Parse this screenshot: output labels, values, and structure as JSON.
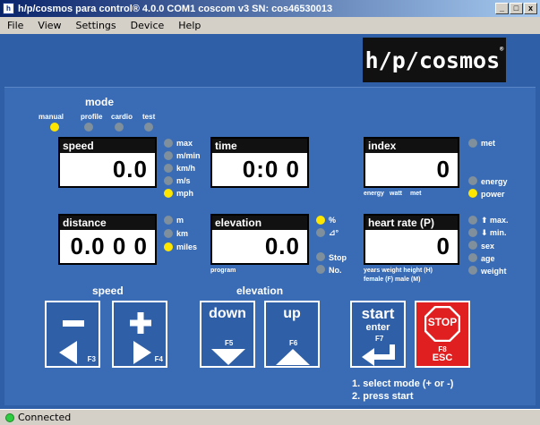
{
  "window": {
    "title": "h/p/cosmos para control® 4.0.0 COM1 coscom v3  SN: cos46530013",
    "app_icon": "hp-cosmos-app-icon",
    "minimize": "_",
    "maximize": "□",
    "close": "x"
  },
  "menu": [
    "File",
    "View",
    "Settings",
    "Device",
    "Help"
  ],
  "logo": {
    "text": "h/p/cosmos",
    "reg": "®"
  },
  "mode": {
    "title": "mode",
    "options": [
      {
        "label": "manual",
        "active": true
      },
      {
        "label": "profile",
        "active": false
      },
      {
        "label": "cardio",
        "active": false
      },
      {
        "label": "test",
        "active": false
      }
    ]
  },
  "speed_display": {
    "label": "speed",
    "value": "0.0",
    "units": [
      {
        "label": "max",
        "active": false
      },
      {
        "label": "m/min",
        "active": false
      },
      {
        "label": "km/h",
        "active": false
      },
      {
        "label": "m/s",
        "active": false
      },
      {
        "label": "mph",
        "active": true
      }
    ]
  },
  "time_display": {
    "label": "time",
    "value": "0:0 0"
  },
  "index_display": {
    "label": "index",
    "value": "0",
    "sub": [
      "energy",
      "watt",
      "met"
    ],
    "options": [
      {
        "label": "met",
        "active": false
      },
      {
        "label": "energy",
        "active": false
      },
      {
        "label": "power",
        "active": true
      }
    ]
  },
  "distance_display": {
    "label": "distance",
    "value": "0.0 0 0",
    "units": [
      {
        "label": "m",
        "active": false
      },
      {
        "label": "km",
        "active": false
      },
      {
        "label": "miles",
        "active": true
      }
    ]
  },
  "elevation_display": {
    "label": "elevation",
    "value": "0.0",
    "sub": "program",
    "units": [
      {
        "label": "%",
        "active": true
      },
      {
        "label": "⊿°",
        "active": false
      },
      {
        "label": "Stop",
        "active": false
      },
      {
        "label": "No.",
        "active": false
      }
    ]
  },
  "heart_display": {
    "label": "heart rate (P)",
    "value": "0",
    "sub1": "years  weight  height (H)",
    "sub2": "female (F)  male (M)",
    "options": [
      {
        "label": "⬆ max.",
        "active": false
      },
      {
        "label": "⬇ min.",
        "active": false
      },
      {
        "label": "sex",
        "active": false
      },
      {
        "label": "age",
        "active": false
      },
      {
        "label": "weight",
        "active": false
      }
    ]
  },
  "controls": {
    "speed_title": "speed",
    "elevation_title": "elevation",
    "speed_minus_key": "F3",
    "speed_plus_key": "F4",
    "down_label": "down",
    "down_key": "F5",
    "up_label": "up",
    "up_key": "F6",
    "start_label": "start",
    "start_sub": "enter",
    "start_key": "F7",
    "stop_label": "STOP",
    "stop_key": "F8",
    "stop_sub": "ESC"
  },
  "instructions": [
    "1. select mode (+ or -)",
    "2. press start"
  ],
  "status": {
    "text": "Connected"
  },
  "colors": {
    "panel": "#3a6cb5",
    "active_dot": "#ffe600",
    "inactive_dot": "#7f8f9c",
    "stop": "#e02020"
  }
}
